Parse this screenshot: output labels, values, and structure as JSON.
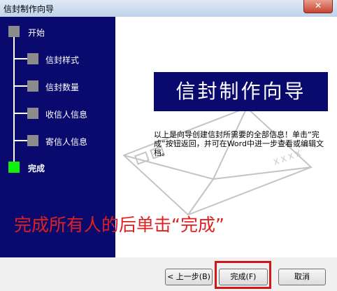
{
  "window": {
    "title": "信封制作向导",
    "close_label": "✕"
  },
  "steps": [
    {
      "label": "开始",
      "state": "done"
    },
    {
      "label": "信封样式",
      "state": "done"
    },
    {
      "label": "信封数量",
      "state": "done"
    },
    {
      "label": "收信人信息",
      "state": "done"
    },
    {
      "label": "寄信人信息",
      "state": "done"
    },
    {
      "label": "完成",
      "state": "current"
    }
  ],
  "colors": {
    "sidebar": "#0a0a6e",
    "current_step": "#10f010",
    "pending_step": "#8c8c8c",
    "annotation": "#e02020"
  },
  "main": {
    "banner": "信封制作向导",
    "info_text": "以上是向导创建信封所需要的全部信息！单击“完成”按钮返回，并可在Word中进一步查看或编辑文档。",
    "envelope_text": "X X X X"
  },
  "annotation": "完成所有人的后单击“完成”",
  "buttons": {
    "back": "< 上一步(B)",
    "finish": "完成(F)",
    "cancel": "取消"
  }
}
